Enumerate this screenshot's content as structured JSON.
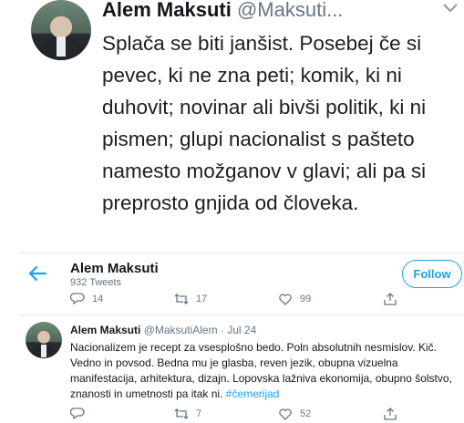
{
  "zoomed_tweet": {
    "author_name": "Alem Maksuti",
    "author_handle": "@Maksuti...",
    "text": "Splača se biti janšist. Posebej če si pevec, ki ne zna peti; komik, ki ni duhovit; novinar ali bivši politik, ki ni pismen; glupi nacionalist s pašteto namesto možganov v glavi; ali pa si preprosto gnjida od človeka."
  },
  "profile_header": {
    "name": "Alem Maksuti",
    "tweet_count": "932 Tweets",
    "follow_label": "Follow"
  },
  "first_tweet_actions": {
    "replies": "14",
    "retweets": "17",
    "likes": "99"
  },
  "second_tweet": {
    "author_name": "Alem Maksuti",
    "meta": "@MaksutiAlem · Jul 24",
    "text": "Nacionalizem je recept za vsesplošno bedo. Poln absolutnih nesmislov. Kič. Vedno in povsod. Bedna mu je glasba, reven jezik, obupna vizuelna manifestacija, arhitektura, dizajn. Lopovska lažniva ekonomija, obupno šolstvo, znanosti in umetnosti pa itak ni.",
    "hashtag": "#čemerijad",
    "replies": "",
    "retweets": "7",
    "likes": "52"
  },
  "colors": {
    "accent": "#1da1f2",
    "secondary_text": "#657786",
    "divider": "#e6ecf0"
  },
  "icons": [
    "chevron-down-icon",
    "back-arrow-icon",
    "reply-icon",
    "retweet-icon",
    "like-icon",
    "share-icon"
  ]
}
